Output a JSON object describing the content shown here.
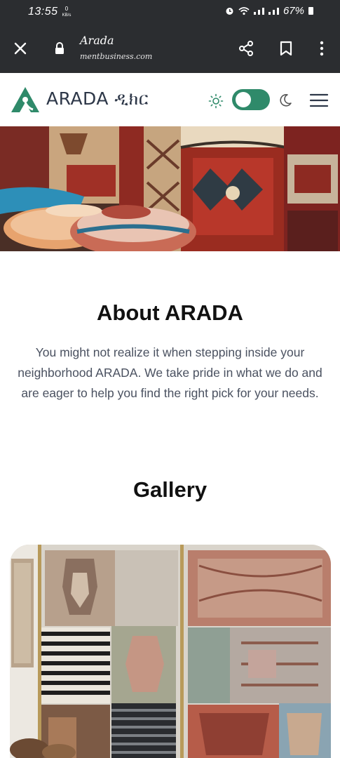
{
  "status_bar": {
    "time": "13:55",
    "net_speed_value": "0",
    "net_speed_unit": "KB/s",
    "battery": "67%"
  },
  "browser": {
    "page_title": "Arada",
    "domain": "mentbusiness.com",
    "icons": [
      "close-icon",
      "lock-icon",
      "share-icon",
      "bookmark-icon",
      "more-vert-icon"
    ]
  },
  "header": {
    "brand": "ARADA ዲክር",
    "theme_toggle": {
      "state": "on",
      "accent": "#2f8a6a"
    },
    "icons": [
      "sun-icon",
      "moon-icon",
      "hamburger-icon"
    ],
    "logo_color": "#2f8a6a"
  },
  "about": {
    "title": "About ARADA",
    "text": "You might not realize it when stepping inside your neighborhood ARADA. We take pride in what we do and are eager to help you find the right pick for your needs."
  },
  "gallery": {
    "title": "Gallery"
  },
  "colors": {
    "chrome_bg": "#2b2d30",
    "heading": "#111111",
    "body_text": "#4a5160",
    "brand_text": "#2d3748"
  }
}
